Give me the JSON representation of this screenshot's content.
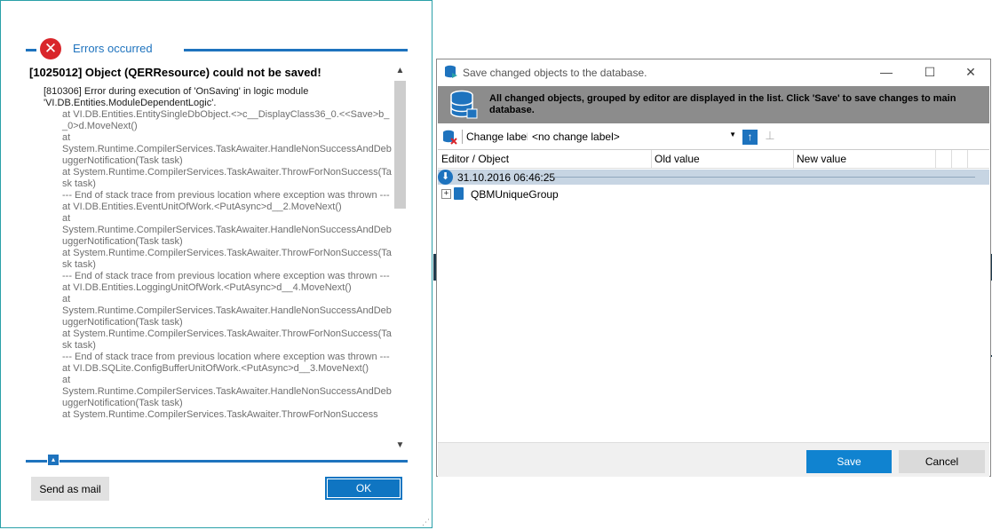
{
  "error_dialog": {
    "header_title": "Errors occurred",
    "error_title": "[1025012] Object (QERResource) could not be saved!",
    "message": "[810306] Error during execution of 'OnSaving' in logic module 'VI.DB.Entities.ModuleDependentLogic'.",
    "stack_lines": [
      "at VI.DB.Entities.EntitySingleDbObject.<>c__DisplayClass36_0.<<Save>b__0>d.MoveNext()",
      "at",
      "System.Runtime.CompilerServices.TaskAwaiter.HandleNonSuccessAndDebuggerNotification(Task task)",
      "at System.Runtime.CompilerServices.TaskAwaiter.ThrowForNonSuccess(Task task)",
      "--- End of stack trace from previous location where exception was thrown ---",
      "at VI.DB.Entities.EventUnitOfWork.<PutAsync>d__2.MoveNext()",
      "at",
      "System.Runtime.CompilerServices.TaskAwaiter.HandleNonSuccessAndDebuggerNotification(Task task)",
      "at System.Runtime.CompilerServices.TaskAwaiter.ThrowForNonSuccess(Task task)",
      "--- End of stack trace from previous location where exception was thrown ---",
      "at VI.DB.Entities.LoggingUnitOfWork.<PutAsync>d__4.MoveNext()",
      "at",
      "System.Runtime.CompilerServices.TaskAwaiter.HandleNonSuccessAndDebuggerNotification(Task task)",
      "at System.Runtime.CompilerServices.TaskAwaiter.ThrowForNonSuccess(Task task)",
      "--- End of stack trace from previous location where exception was thrown ---",
      "at VI.DB.SQLite.ConfigBufferUnitOfWork.<PutAsync>d__3.MoveNext()",
      "at",
      "System.Runtime.CompilerServices.TaskAwaiter.HandleNonSuccessAndDebuggerNotification(Task task)",
      "at System.Runtime.CompilerServices.TaskAwaiter.ThrowForNonSuccess"
    ],
    "send_mail_label": "Send as mail",
    "ok_label": "OK"
  },
  "save_dialog": {
    "title": "Save changed objects to the database.",
    "banner_text": "All changed objects, grouped by editor are displayed in the list. Click 'Save' to save changes to main database.",
    "change_label_caption": "Change label",
    "change_label_value": "<no change label>",
    "columns": [
      "Editor / Object",
      "Old value",
      "New value"
    ],
    "group_date": "31.10.2016 06:46:25",
    "object_name": "QBMUniqueGroup",
    "save_label": "Save",
    "cancel_label": "Cancel"
  },
  "colors": {
    "accent": "#1e73be",
    "error_red": "#d9262b",
    "banner_gray": "#8c8c8c",
    "selection": "#c7d5e3"
  },
  "icons": {
    "error": "error-circle-icon",
    "database": "database-save-icon",
    "arrow_up": "arrow-up-icon",
    "pin": "pin-icon"
  }
}
